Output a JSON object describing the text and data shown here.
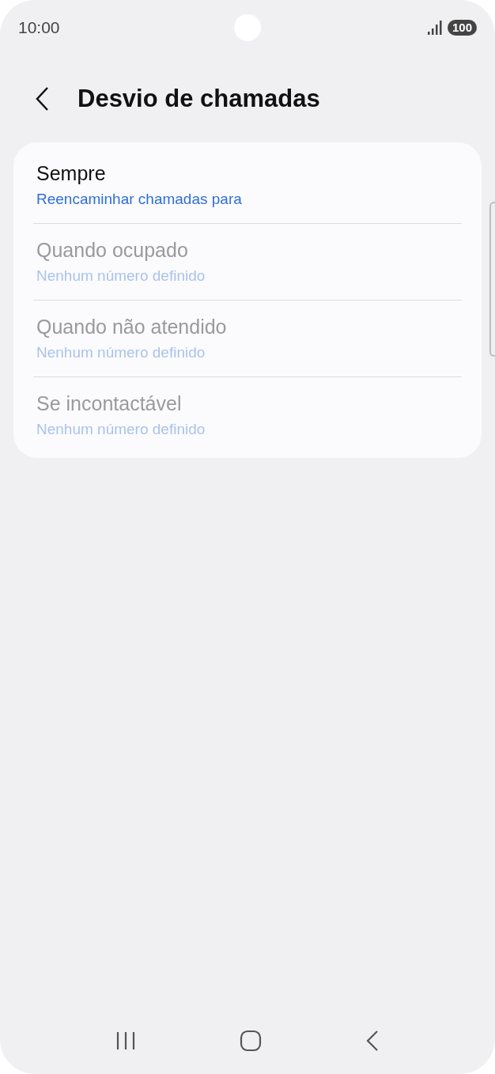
{
  "status_bar": {
    "time": "10:00",
    "battery": "100"
  },
  "header": {
    "title": "Desvio de chamadas"
  },
  "options": [
    {
      "title": "Sempre",
      "subtitle": "Reencaminhar chamadas para",
      "disabled": false
    },
    {
      "title": "Quando ocupado",
      "subtitle": "Nenhum número definido",
      "disabled": true
    },
    {
      "title": "Quando não atendido",
      "subtitle": "Nenhum número definido",
      "disabled": true
    },
    {
      "title": "Se incontactável",
      "subtitle": "Nenhum número definido",
      "disabled": true
    }
  ]
}
